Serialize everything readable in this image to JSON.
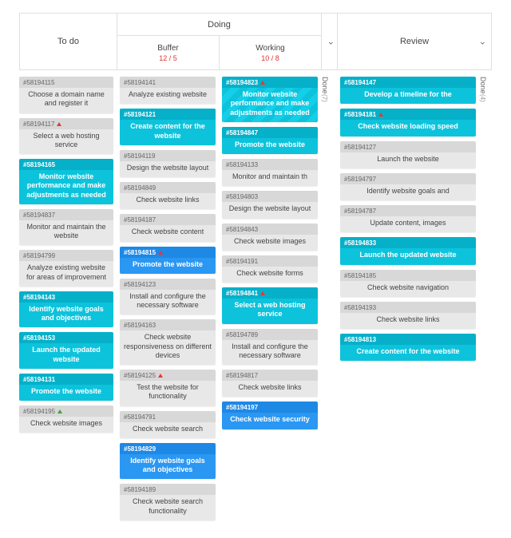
{
  "headers": {
    "todo": "To do",
    "doing": "Doing",
    "buffer": {
      "label": "Buffer",
      "wip": "12 / 5"
    },
    "working": {
      "label": "Working",
      "wip": "10 / 8"
    },
    "review": "Review",
    "done_label": "Done",
    "done_count_doing": "(7)",
    "done_count_review": "(4)"
  },
  "columns": {
    "todo": [
      {
        "id": "#58194115",
        "title": "Choose a domain name and register it",
        "color": "grey"
      },
      {
        "id": "#58194117",
        "title": "Select a web hosting service",
        "color": "grey",
        "flag": "red"
      },
      {
        "id": "#58194165",
        "title": "Monitor website performance and make adjustments as needed",
        "color": "teal"
      },
      {
        "id": "#58194837",
        "title": "Monitor and maintain the website",
        "color": "grey"
      },
      {
        "id": "#58194799",
        "title": "Analyze existing website for areas of improvement",
        "color": "grey"
      },
      {
        "id": "#58194143",
        "title": "Identify website goals and objectives",
        "color": "teal"
      },
      {
        "id": "#58194153",
        "title": "Launch the updated website",
        "color": "teal"
      },
      {
        "id": "#58194131",
        "title": "Promote the website",
        "color": "teal"
      },
      {
        "id": "#58194195",
        "title": "Check website images",
        "color": "grey",
        "flag": "green"
      }
    ],
    "buffer": [
      {
        "id": "#58194141",
        "title": "Analyze existing website",
        "color": "grey"
      },
      {
        "id": "#58194121",
        "title": "Create content for the website",
        "color": "teal"
      },
      {
        "id": "#58194119",
        "title": "Design the website layout",
        "color": "grey"
      },
      {
        "id": "#58194849",
        "title": "Check website links",
        "color": "grey"
      },
      {
        "id": "#58194187",
        "title": "Check website content",
        "color": "grey"
      },
      {
        "id": "#58194815",
        "title": "Promote the website",
        "color": "blue",
        "flag": "red"
      },
      {
        "id": "#58194123",
        "title": "Install and configure the necessary software",
        "color": "grey"
      },
      {
        "id": "#58194163",
        "title": "Check website responsiveness on different devices",
        "color": "grey"
      },
      {
        "id": "#58194125",
        "title": "Test the website for functionality",
        "color": "grey",
        "flag": "red"
      },
      {
        "id": "#58194791",
        "title": "Check website search",
        "color": "grey"
      },
      {
        "id": "#58194829",
        "title": "Identify website goals and objectives",
        "color": "blue"
      },
      {
        "id": "#58194189",
        "title": "Check website search functionality",
        "color": "grey"
      }
    ],
    "working": [
      {
        "id": "#58194823",
        "title": "Monitor website performance and make adjustments as needed",
        "color": "teal",
        "flag": "red",
        "striped": true
      },
      {
        "id": "#58194847",
        "title": "Promote the website",
        "color": "teal"
      },
      {
        "id": "#58194133",
        "title": "Monitor and maintain th",
        "color": "grey"
      },
      {
        "id": "#58194803",
        "title": "Design the website layout",
        "color": "grey"
      },
      {
        "id": "#58194843",
        "title": "Check website images",
        "color": "grey"
      },
      {
        "id": "#58194191",
        "title": "Check website forms",
        "color": "grey"
      },
      {
        "id": "#58194841",
        "title": "Select a web hosting service",
        "color": "teal",
        "flag": "red"
      },
      {
        "id": "#58194789",
        "title": "Install and configure the necessary software",
        "color": "grey"
      },
      {
        "id": "#58194817",
        "title": "Check website links",
        "color": "grey"
      },
      {
        "id": "#58194197",
        "title": "Check website security",
        "color": "blue"
      }
    ],
    "review": [
      {
        "id": "#58194147",
        "title": "Develop a timeline for the",
        "color": "teal"
      },
      {
        "id": "#58194181",
        "title": "Check website loading speed",
        "color": "teal",
        "flag": "red"
      },
      {
        "id": "#58194127",
        "title": "Launch the website",
        "color": "grey"
      },
      {
        "id": "#58194797",
        "title": "Identify website goals and",
        "color": "grey"
      },
      {
        "id": "#58194787",
        "title": "Update content, images",
        "color": "grey"
      },
      {
        "id": "#58194833",
        "title": "Launch the updated website",
        "color": "teal"
      },
      {
        "id": "#58194185",
        "title": "Check website navigation",
        "color": "grey"
      },
      {
        "id": "#58194193",
        "title": "Check website links",
        "color": "grey"
      },
      {
        "id": "#58194813",
        "title": "Create content for the website",
        "color": "teal"
      }
    ]
  }
}
